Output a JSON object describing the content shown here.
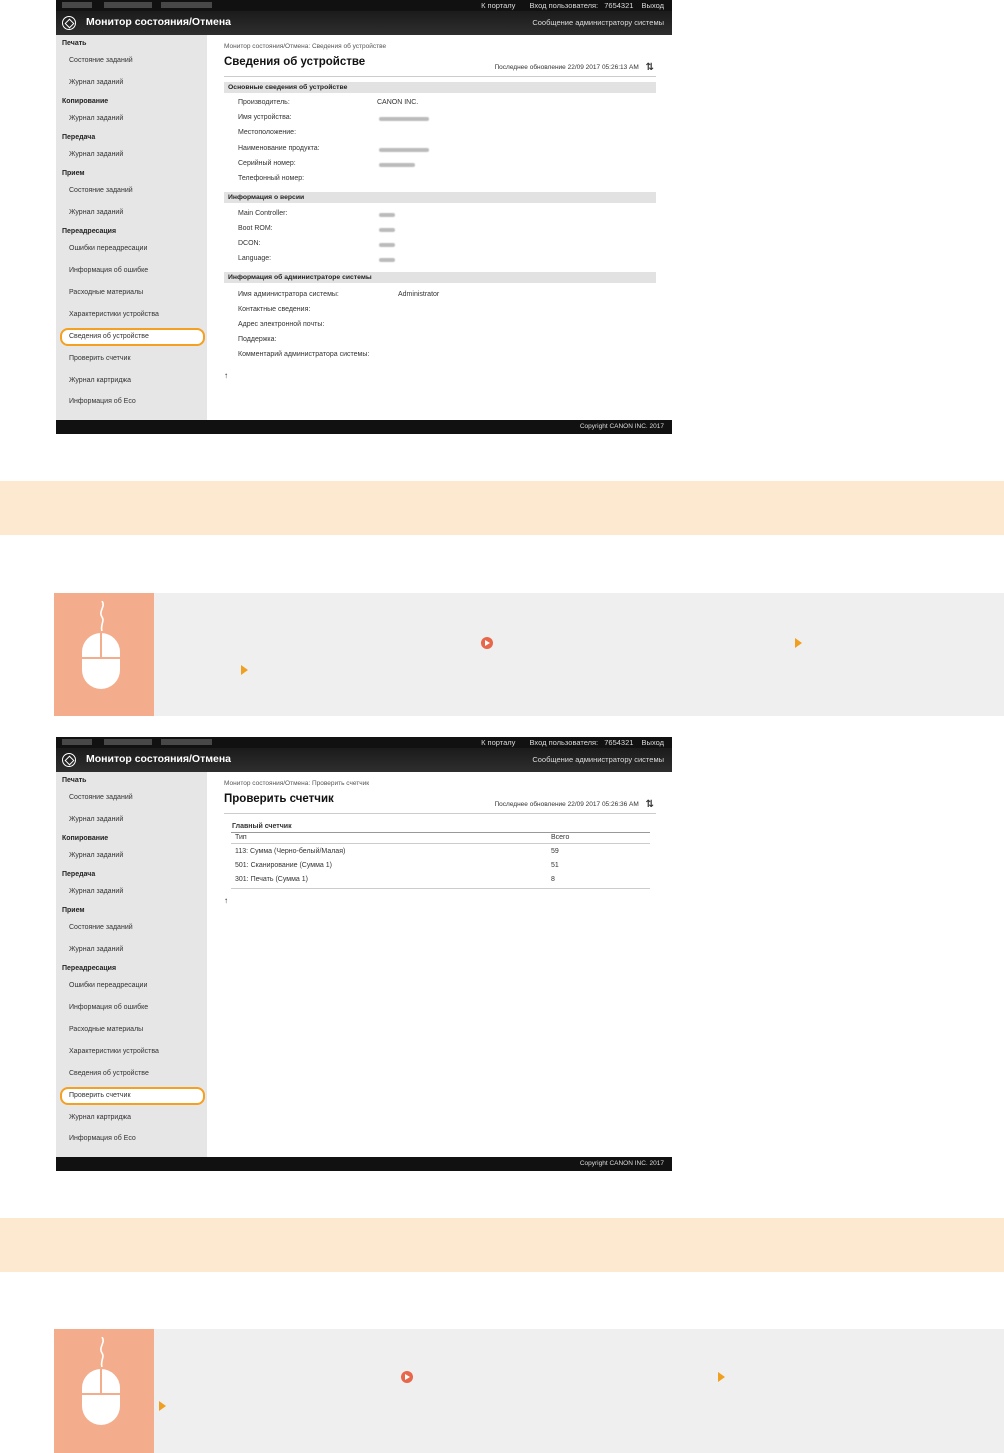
{
  "topbar": {
    "portal": "К порталу",
    "login": "Вход пользователя:",
    "user_id": "7654321",
    "logout": "Выход"
  },
  "app": {
    "title": "Монитор состояния/Отмена",
    "admin_message": "Сообщение администратору системы"
  },
  "sidebar": {
    "print": "Печать",
    "print_status": "Состояние заданий",
    "print_log": "Журнал заданий",
    "copy": "Копирование",
    "copy_log": "Журнал заданий",
    "send": "Передача",
    "send_log": "Журнал заданий",
    "receive": "Прием",
    "receive_status": "Состояние заданий",
    "receive_log": "Журнал заданий",
    "forward": "Переадресация",
    "forward_errors": "Ошибки переадресации",
    "error_info": "Информация об ошибке",
    "consumables": "Расходные материалы",
    "device_features": "Характеристики устройства",
    "device_info": "Сведения об устройстве",
    "check_counter": "Проверить счетчик",
    "cartridge_log": "Журнал картриджа",
    "eco_info": "Информация об Eco"
  },
  "screen1": {
    "breadcrumb": "Монитор состояния/Отмена: Сведения об устройстве",
    "title": "Сведения об устройстве",
    "last_update": "Последнее обновление 22/09 2017 05:26:13 AM",
    "sec_basic": "Основные сведения об устройстве",
    "manufacturer_label": "Производитель:",
    "manufacturer_value": "CANON INC.",
    "device_name_label": "Имя устройства:",
    "location_label": "Местоположение:",
    "product_name_label": "Наименование продукта:",
    "serial_label": "Серийный номер:",
    "phone_label": "Телефонный номер:",
    "sec_version": "Информация о версии",
    "main_controller_label": "Main Controller:",
    "boot_rom_label": "Boot ROM:",
    "dcon_label": "DCON:",
    "language_label": "Language:",
    "sec_admin": "Информация об администраторе системы",
    "admin_name_label": "Имя администратора системы:",
    "admin_name_value": "Administrator",
    "contact_label": "Контактные сведения:",
    "email_label": "Адрес электронной почты:",
    "support_label": "Поддержка:",
    "comment_label": "Комментарий администратора системы:",
    "to_top": "↑"
  },
  "screen2": {
    "breadcrumb": "Монитор состояния/Отмена: Проверить счетчик",
    "title": "Проверить счетчик",
    "last_update": "Последнее обновление 22/09 2017 05:26:36 AM",
    "counter_heading": "Главный счетчик",
    "col_type": "Тип",
    "col_total": "Всего",
    "rows": [
      {
        "type": "113: Сумма (Черно-белый/Малая)",
        "total": "59"
      },
      {
        "type": "501: Сканирование (Сумма 1)",
        "total": "51"
      },
      {
        "type": "301: Печать (Сумма 1)",
        "total": "8"
      }
    ],
    "to_top": "↑"
  },
  "footer": {
    "copyright": "Copyright CANON INC. 2017"
  },
  "colors": {
    "highlight": "#f4a020",
    "band": "#fce9cf",
    "note_icon_bg": "#f4ad8c",
    "note_bg": "#efefef"
  }
}
